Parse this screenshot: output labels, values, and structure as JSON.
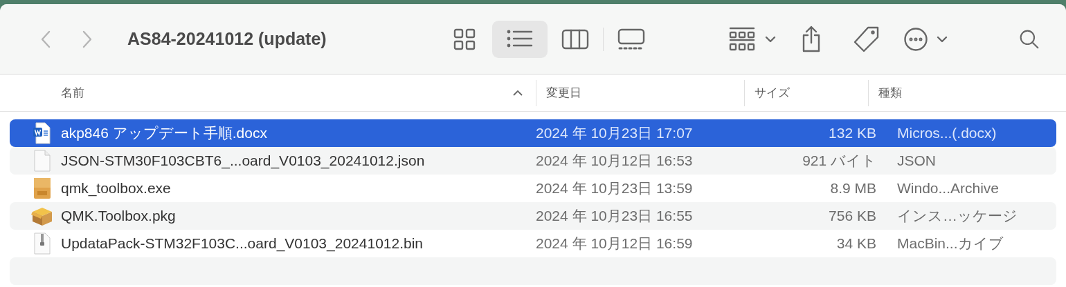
{
  "window": {
    "title": "AS84-20241012 (update)"
  },
  "navigation": {
    "back_enabled": false,
    "forward_enabled": false
  },
  "view_modes": [
    {
      "kind": "icons",
      "selected": false
    },
    {
      "kind": "list",
      "selected": true
    },
    {
      "kind": "columns",
      "selected": false
    },
    {
      "kind": "gallery",
      "selected": false
    }
  ],
  "columns": [
    {
      "label": "名前",
      "sorted": true
    },
    {
      "label": "変更日",
      "sorted": false
    },
    {
      "label": "サイズ",
      "sorted": false
    },
    {
      "label": "種類",
      "sorted": false
    }
  ],
  "rows": [
    {
      "kind": "word",
      "name": "akp846 アップデート手順.docx",
      "date": "2024 年 10月23日 17:07",
      "size": "132 KB",
      "type": "Micros...(.docx)",
      "selected": true
    },
    {
      "kind": "document",
      "name": "JSON-STM30F103CBT6_...oard_V0103_20241012.json",
      "date": "2024 年 10月12日 16:53",
      "size": "921 バイト",
      "type": "JSON",
      "selected": false
    },
    {
      "kind": "exe",
      "name": "qmk_toolbox.exe",
      "date": "2024 年 10月23日 13:59",
      "size": "8.9 MB",
      "type": "Windo...Archive",
      "selected": false
    },
    {
      "kind": "package",
      "name": "QMK.Toolbox.pkg",
      "date": "2024 年 10月23日 16:55",
      "size": "756 KB",
      "type": "インス…ッケージ",
      "selected": false
    },
    {
      "kind": "binary",
      "name": "UpdataPack-STM32F103C...oard_V0103_20241012.bin",
      "date": "2024 年 10月12日 16:59",
      "size": "34 KB",
      "type": "MacBin...カイブ",
      "selected": false
    }
  ]
}
